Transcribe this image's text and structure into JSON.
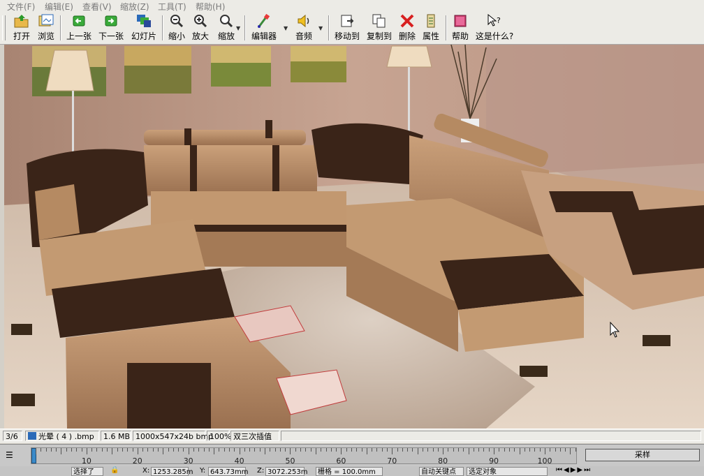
{
  "menu": [
    "文件(F)",
    "编辑(E)",
    "查看(V)",
    "缩放(Z)",
    "工具(T)",
    "帮助(H)"
  ],
  "toolbar": {
    "open": "打开",
    "browse": "浏览",
    "prev": "上一张",
    "next": "下一张",
    "slideshow": "幻灯片",
    "zoom_out": "缩小",
    "zoom_in": "放大",
    "zoom": "缩放",
    "editor": "编辑器",
    "audio": "音频",
    "move_to": "移动到",
    "copy_to": "复制到",
    "delete": "删除",
    "properties": "属性",
    "help": "帮助",
    "whats_this": "这是什么?"
  },
  "status": {
    "index": "3/6",
    "filename": "光晕 ( 4 ) .bmp",
    "filesize": "1.6 MB",
    "dimensions": "1000x547x24b bmp",
    "zoom": "100%",
    "interpolation": "双三次插值"
  },
  "timeline": {
    "ticks": [
      "10",
      "20",
      "30",
      "40",
      "50",
      "60",
      "70",
      "80",
      "90",
      "100"
    ],
    "sample_label": "采样"
  },
  "bottombar": {
    "select_label": "选择了",
    "x_label": "X:",
    "x_value": "1253.285m",
    "y_label": "Y:",
    "y_value": "643.73mm",
    "z_label": "Z:",
    "z_value": "3072.253m",
    "grid": "栅格 = 100.0mm",
    "autokey": "自动关键点",
    "selected_obj": "选定对象"
  },
  "colors": {
    "wall": "#b48e7b",
    "floor": "#d9c5b2",
    "sofa_tan": "#b98a60",
    "sofa_dark": "#3a2418",
    "rug": "#c9b39e"
  }
}
